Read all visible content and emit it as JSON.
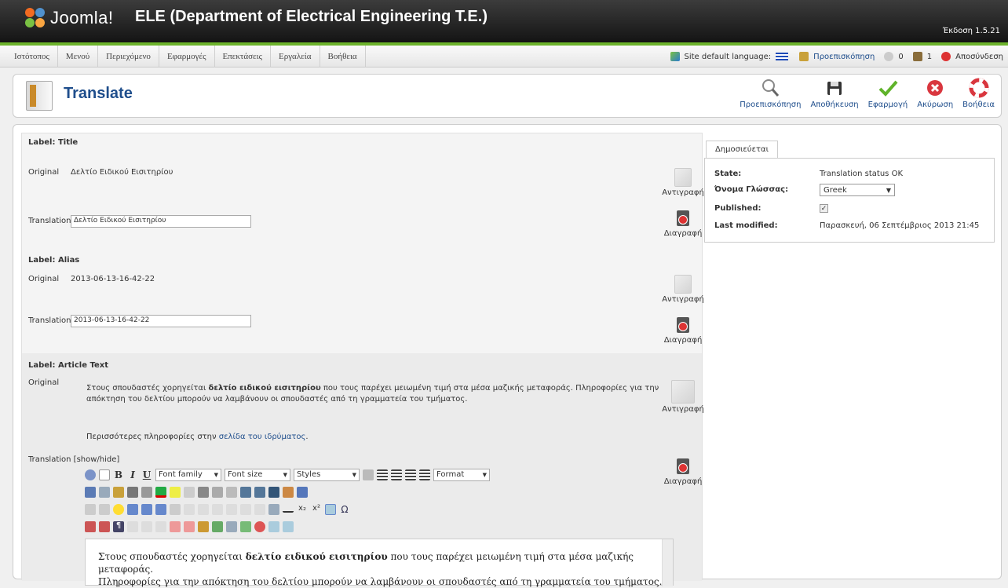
{
  "header": {
    "brand": "Joomla!",
    "site_title": "ELE (Department of Electrical Engineering T.E.)",
    "version": "Έκδοση 1.5.21"
  },
  "menu": {
    "items": [
      {
        "label": "Ιστότοπος"
      },
      {
        "label": "Μενού"
      },
      {
        "label": "Περιεχόμενο"
      },
      {
        "label": "Εφαρμογές"
      },
      {
        "label": "Επεκτάσεις"
      },
      {
        "label": "Εργαλεία"
      },
      {
        "label": "Βοήθεια"
      }
    ],
    "status": {
      "language_label": "Site default language:",
      "preview_label": "Προεπισκόπηση",
      "messages_count": "0",
      "users_count": "1",
      "logout_label": "Αποσύνδεση"
    }
  },
  "toolbar": {
    "title": "Translate",
    "buttons": {
      "preview": "Προεπισκόπηση",
      "save": "Αποθήκευση",
      "apply": "Εφαρμογή",
      "cancel": "Ακύρωση",
      "help": "Βοήθεια"
    }
  },
  "form": {
    "row_original": "Original",
    "row_translation": "Translation",
    "copy_label": "Αντιγραφή",
    "delete_label": "Διαγραφή",
    "title_section": {
      "label": "Label: Title",
      "original": "Δελτίο Ειδικού Εισιτηρίου",
      "translation": "Δελτίο Ειδικού Εισιτηρίου"
    },
    "alias_section": {
      "label": "Label: Alias",
      "original": "2013-06-13-16-42-22",
      "translation": "2013-06-13-16-42-22"
    },
    "article_section": {
      "label": "Label: Article Text",
      "original_p1_pre": "Στους σπουδαστές χορηγείται ",
      "original_p1_bold": "δελτίο ειδικού εισιτηρίου",
      "original_p1_post": " που τους παρέχει μειωμένη τιμή στα μέσα μαζικής μεταφοράς. Πληροφορίες για την απόκτηση του δελτίου μπορούν να λαμβάνουν οι σπουδαστές από τη γραμματεία του τμήματος.",
      "original_p2_pre": "Περισσότερες πληροφορίες στην ",
      "original_p2_link": "σελίδα του ιδρύματος",
      "original_p2_post": ".",
      "translation_toggle": "Translation [show/hide]"
    }
  },
  "editor": {
    "font_family": "Font family",
    "font_size": "Font size",
    "styles": "Styles",
    "format": "Format",
    "content_line1_pre": "Στους σπουδαστές χορηγείται ",
    "content_line1_bold": "δελτίο ειδικού εισιτηρίου",
    "content_line1_post": " που τους παρέχει μειωμένη τιμή στα μέσα μαζικής μεταφοράς.",
    "content_line2": "Πληροφορίες για την απόκτηση του δελτίου μπορούν να λαμβάνουν οι σπουδαστές από τη γραμματεία του τμήματος."
  },
  "sidepanel": {
    "tab": "Δημοσιεύεται",
    "rows": [
      {
        "key": "State:",
        "value": "Translation status OK"
      },
      {
        "key": "Όνομα Γλώσσας:",
        "value": "Greek"
      },
      {
        "key": "Published:",
        "value": "✓"
      },
      {
        "key": "Last modified:",
        "value": "Παρασκευή, 06 Σεπτέμβριος 2013 21:45"
      }
    ]
  },
  "colors": {
    "accent_green": "#6db32c",
    "link_blue": "#1f4e8c",
    "header_dark": "#111111"
  }
}
